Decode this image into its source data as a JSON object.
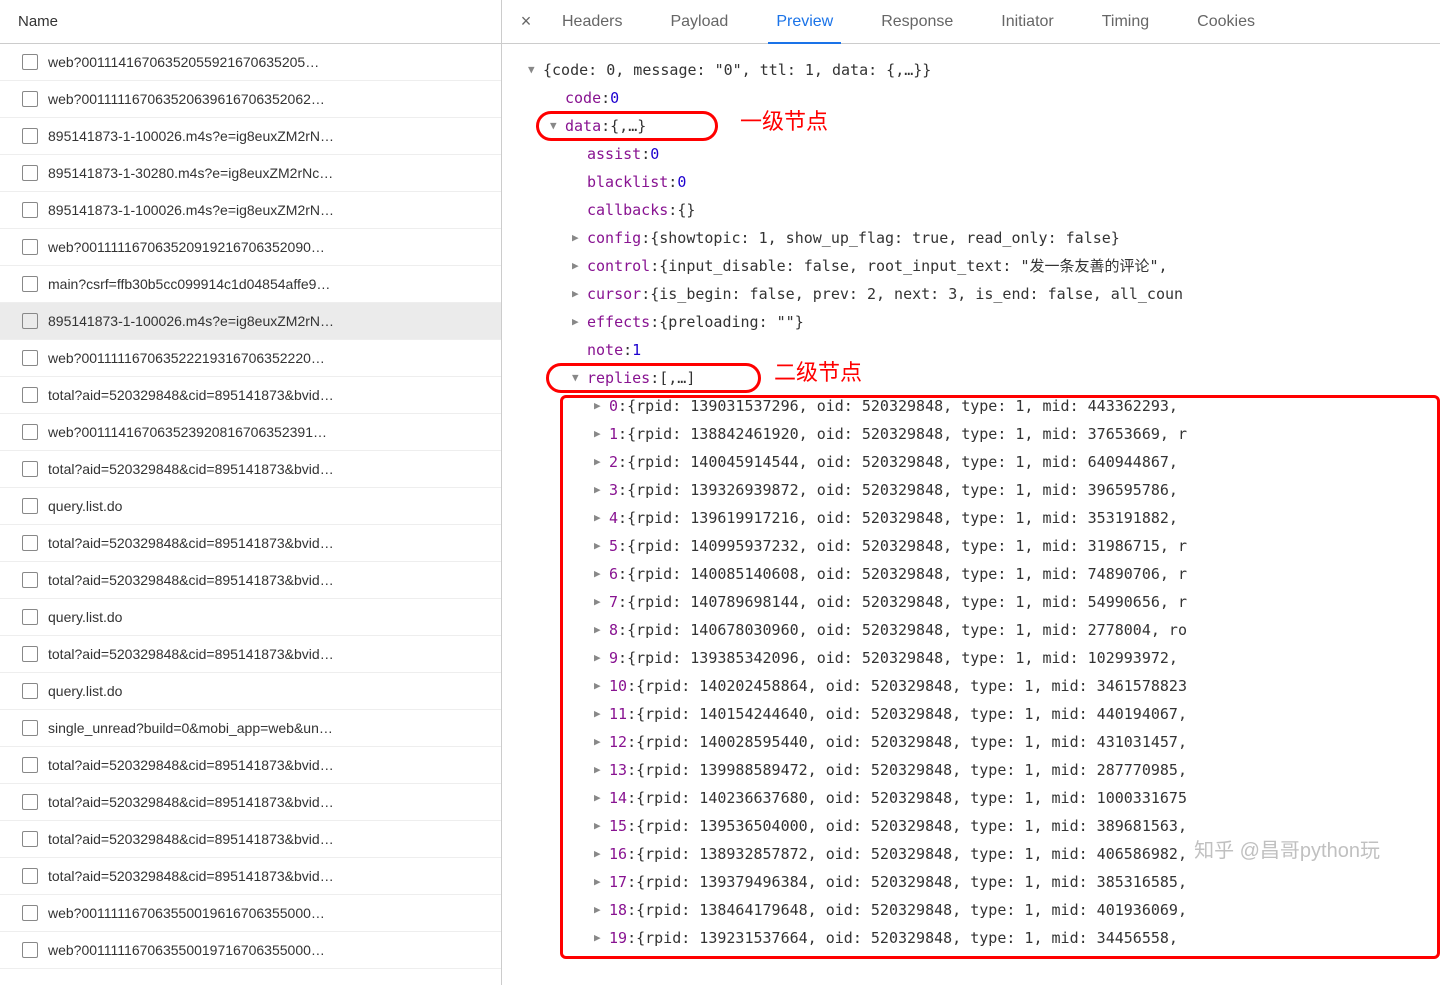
{
  "left": {
    "header": "Name",
    "selectedIndex": 7,
    "requests": [
      "web?00111416706352055921670635205…",
      "web?001111167063520639616706352062…",
      "895141873-1-100026.m4s?e=ig8euxZM2rN…",
      "895141873-1-30280.m4s?e=ig8euxZM2rNc…",
      "895141873-1-100026.m4s?e=ig8euxZM2rN…",
      "web?001111167063520919216706352090…",
      "main?csrf=ffb30b5cc099914c1d04854affe9…",
      "895141873-1-100026.m4s?e=ig8euxZM2rN…",
      "web?001111167063522219316706352220…",
      "total?aid=520329848&cid=895141873&bvid…",
      "web?001114167063523920816706352391…",
      "total?aid=520329848&cid=895141873&bvid…",
      "query.list.do",
      "total?aid=520329848&cid=895141873&bvid…",
      "total?aid=520329848&cid=895141873&bvid…",
      "query.list.do",
      "total?aid=520329848&cid=895141873&bvid…",
      "query.list.do",
      "single_unread?build=0&mobi_app=web&un…",
      "total?aid=520329848&cid=895141873&bvid…",
      "total?aid=520329848&cid=895141873&bvid…",
      "total?aid=520329848&cid=895141873&bvid…",
      "total?aid=520329848&cid=895141873&bvid…",
      "web?001111167063550019616706355000…",
      "web?001111167063550019716706355000…"
    ]
  },
  "tabs": [
    "Headers",
    "Payload",
    "Preview",
    "Response",
    "Initiator",
    "Timing",
    "Cookies"
  ],
  "activeTab": 2,
  "annotations": {
    "level1": "一级节点",
    "level2": "二级节点",
    "watermark": "知乎 @昌哥python玩"
  },
  "json": {
    "rootSummary": "{code: 0, message: \"0\", ttl: 1, data: {,…}}",
    "code": 0,
    "dataSummary": "{,…}",
    "assist": 0,
    "blacklist": 0,
    "callbacks": "{}",
    "config": "{showtopic: 1, show_up_flag: true, read_only: false}",
    "control": "{input_disable: false, root_input_text: \"发一条友善的评论\",",
    "cursor": "{is_begin: false, prev: 2, next: 3, is_end: false, all_coun",
    "effects": "{preloading: \"\"}",
    "note": 1,
    "repliesSummary": "[,…]",
    "replies": [
      {
        "i": 0,
        "rpid": "139031537296",
        "oid": "520329848",
        "type": 1,
        "mid": "443362293,"
      },
      {
        "i": 1,
        "rpid": "138842461920",
        "oid": "520329848",
        "type": 1,
        "mid": "37653669, r"
      },
      {
        "i": 2,
        "rpid": "140045914544",
        "oid": "520329848",
        "type": 1,
        "mid": "640944867,"
      },
      {
        "i": 3,
        "rpid": "139326939872",
        "oid": "520329848",
        "type": 1,
        "mid": "396595786,"
      },
      {
        "i": 4,
        "rpid": "139619917216",
        "oid": "520329848",
        "type": 1,
        "mid": "353191882,"
      },
      {
        "i": 5,
        "rpid": "140995937232",
        "oid": "520329848",
        "type": 1,
        "mid": "31986715, r"
      },
      {
        "i": 6,
        "rpid": "140085140608",
        "oid": "520329848",
        "type": 1,
        "mid": "74890706, r"
      },
      {
        "i": 7,
        "rpid": "140789698144",
        "oid": "520329848",
        "type": 1,
        "mid": "54990656, r"
      },
      {
        "i": 8,
        "rpid": "140678030960",
        "oid": "520329848",
        "type": 1,
        "mid": "2778004, ro"
      },
      {
        "i": 9,
        "rpid": "139385342096",
        "oid": "520329848",
        "type": 1,
        "mid": "102993972,"
      },
      {
        "i": 10,
        "rpid": "140202458864",
        "oid": "520329848",
        "type": 1,
        "mid": "3461578823"
      },
      {
        "i": 11,
        "rpid": "140154244640",
        "oid": "520329848",
        "type": 1,
        "mid": "440194067,"
      },
      {
        "i": 12,
        "rpid": "140028595440",
        "oid": "520329848",
        "type": 1,
        "mid": "431031457,"
      },
      {
        "i": 13,
        "rpid": "139988589472",
        "oid": "520329848",
        "type": 1,
        "mid": "287770985,"
      },
      {
        "i": 14,
        "rpid": "140236637680",
        "oid": "520329848",
        "type": 1,
        "mid": "1000331675"
      },
      {
        "i": 15,
        "rpid": "139536504000",
        "oid": "520329848",
        "type": 1,
        "mid": "389681563,"
      },
      {
        "i": 16,
        "rpid": "138932857872",
        "oid": "520329848",
        "type": 1,
        "mid": "406586982,"
      },
      {
        "i": 17,
        "rpid": "139379496384",
        "oid": "520329848",
        "type": 1,
        "mid": "385316585,"
      },
      {
        "i": 18,
        "rpid": "138464179648",
        "oid": "520329848",
        "type": 1,
        "mid": "401936069,"
      },
      {
        "i": 19,
        "rpid": "139231537664",
        "oid": "520329848",
        "type": 1,
        "mid": "34456558, "
      }
    ]
  }
}
